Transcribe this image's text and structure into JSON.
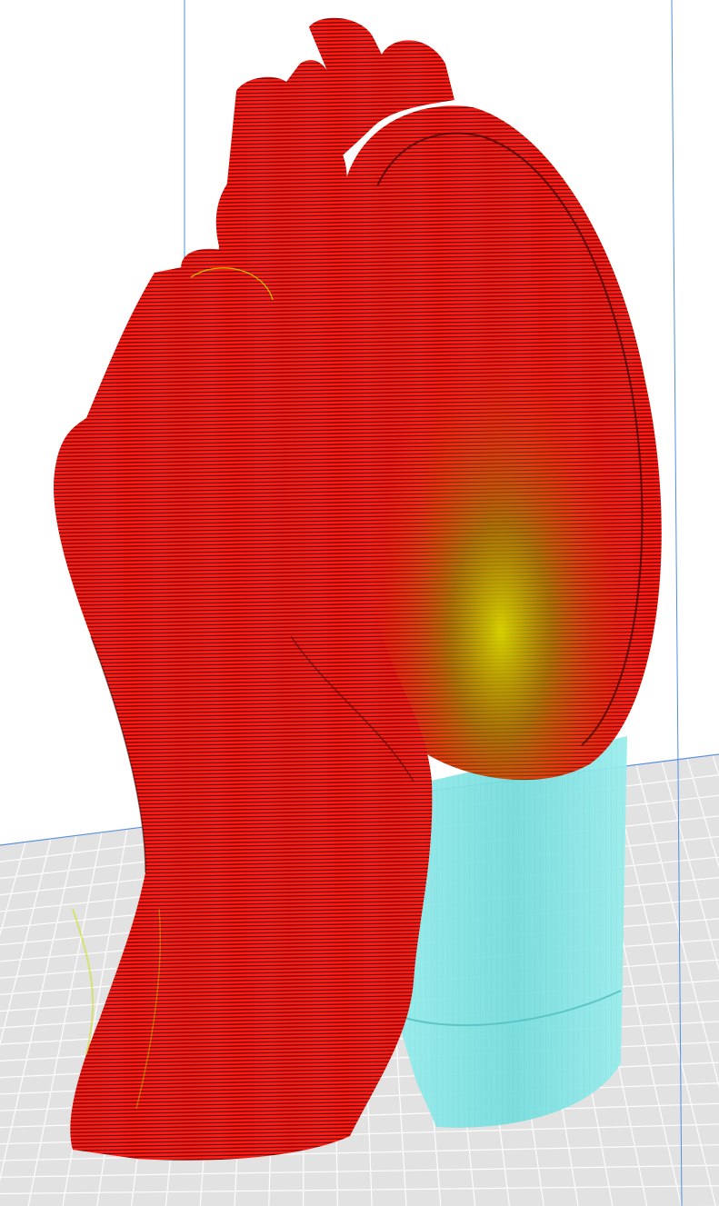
{
  "viewport": {
    "view": "slice preview",
    "background_color": "#ffffff"
  },
  "build_plate": {
    "color": "#e2e2e2",
    "grid_line_color": "#ffffff",
    "edge_line_color": "#5b8fe0"
  },
  "build_volume": {
    "boundary_color": "#4f8fe8"
  },
  "model": {
    "name": "hands-holding-disc",
    "shell_color": "#ff1a12",
    "layer_line_color": "#1a0000",
    "skin_color": "#c8e000",
    "support_color": "#7fe6e6"
  }
}
